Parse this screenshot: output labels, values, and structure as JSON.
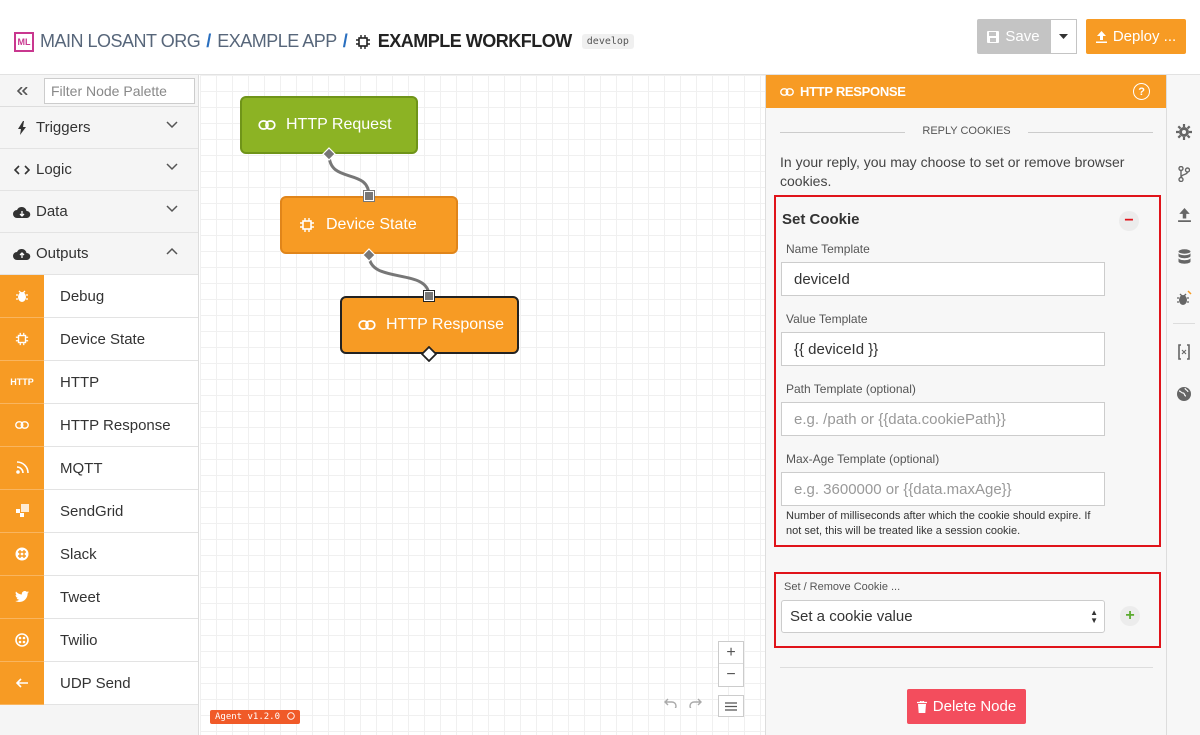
{
  "header": {
    "logo": "ML",
    "org": "MAIN LOSANT ORG",
    "sep": "/",
    "app": "EXAMPLE APP",
    "workflow": "EXAMPLE WORKFLOW",
    "version_badge": "develop",
    "save_label": "Save",
    "deploy_label": "Deploy ..."
  },
  "palette": {
    "filter_placeholder": "Filter Node Palette",
    "categories": [
      {
        "label": "Triggers",
        "icon": "bolt-icon",
        "state": "collapsed"
      },
      {
        "label": "Logic",
        "icon": "code-icon",
        "state": "collapsed"
      },
      {
        "label": "Data",
        "icon": "cloud-download-icon",
        "state": "collapsed"
      },
      {
        "label": "Outputs",
        "icon": "cloud-upload-icon",
        "state": "expanded"
      }
    ],
    "output_nodes": [
      {
        "label": "Debug",
        "icon": "bug-icon"
      },
      {
        "label": "Device State",
        "icon": "chip-icon"
      },
      {
        "label": "HTTP",
        "icon": "http-icon",
        "icon_text": "HTTP"
      },
      {
        "label": "HTTP Response",
        "icon": "link-icon"
      },
      {
        "label": "MQTT",
        "icon": "rss-icon"
      },
      {
        "label": "SendGrid",
        "icon": "sendgrid-icon"
      },
      {
        "label": "Slack",
        "icon": "slack-icon"
      },
      {
        "label": "Tweet",
        "icon": "twitter-icon"
      },
      {
        "label": "Twilio",
        "icon": "twilio-icon"
      },
      {
        "label": "UDP Send",
        "icon": "arrow-left-icon"
      }
    ]
  },
  "canvas": {
    "nodes": [
      {
        "label": "HTTP Request",
        "icon": "link-icon",
        "color": "#8cb324"
      },
      {
        "label": "Device State",
        "icon": "chip-icon",
        "color": "#f79b24"
      },
      {
        "label": "HTTP Response",
        "icon": "link-icon",
        "color": "#f79b24"
      }
    ],
    "zoom_in": "+",
    "zoom_out": "−",
    "agent_badge": "Agent v1.2.0"
  },
  "panel": {
    "title": "HTTP RESPONSE",
    "section": "REPLY COOKIES",
    "intro": "In your reply, you may choose to set or remove browser cookies.",
    "set_cookie": {
      "title": "Set Cookie",
      "name_label": "Name Template",
      "name_value": "deviceId",
      "value_label": "Value Template",
      "value_value": "{{ deviceId }}",
      "path_label": "Path Template (optional)",
      "path_placeholder": "e.g. /path or {{data.cookiePath}}",
      "maxage_label": "Max-Age Template (optional)",
      "maxage_placeholder": "e.g. 3600000 or {{data.maxAge}}",
      "help": "Number of milliseconds after which the cookie should expire. If not set, this will be treated like a session cookie."
    },
    "set_remove": {
      "label": "Set / Remove Cookie ...",
      "selected": "Set a cookie value"
    },
    "delete_label": "Delete Node"
  },
  "colors": {
    "accent": "#f79b24",
    "trigger_green": "#8cb324",
    "danger": "#f34d5d",
    "highlight_red": "#e0131a"
  }
}
